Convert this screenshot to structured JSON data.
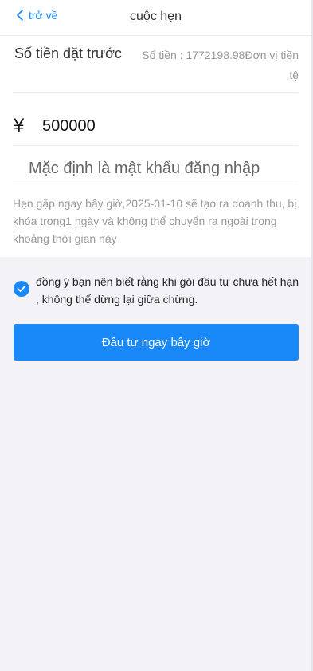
{
  "header": {
    "back_label": "trở về",
    "title": "cuộc hẹn"
  },
  "deposit": {
    "label": "Số tiền đặt trước",
    "balance_text": "Số tiền : 1772198.98Đơn vị tiền tệ"
  },
  "amount": {
    "currency_symbol": "¥",
    "value": "500000"
  },
  "password": {
    "placeholder": "Mặc định là mật khẩu đăng nhập"
  },
  "notice": "Hẹn gặp ngay bây giờ,2025-01-10 sẽ tạo ra doanh thu, bị khóa trong1 ngày và không thể chuyển ra ngoài trong khoảng thời gian này",
  "agreement": {
    "checked": true,
    "text": "đồng ý bạn nên biết rằng khi gói đầu tư chưa hết hạn , không thể dừng lại giữa chừng."
  },
  "submit_label": "Đầu tư ngay bây giờ",
  "colors": {
    "accent": "#1989fa",
    "background": "#f3f3f7"
  },
  "icons": {
    "back": "chevron-left-icon",
    "check": "checkmark-circle-icon"
  }
}
